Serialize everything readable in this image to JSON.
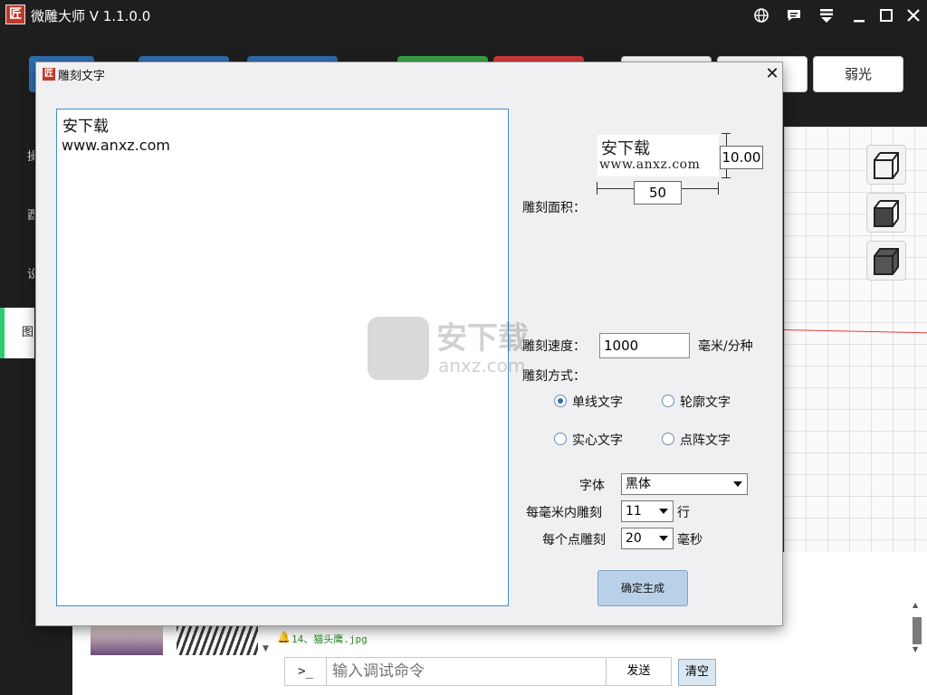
{
  "app": {
    "logo_char": "匠",
    "title": "微雕大师 V 1.1.0.0"
  },
  "titlebar_icons": [
    "globe-icon",
    "message-icon",
    "menu-icon",
    "minimize-icon",
    "maximize-icon",
    "close-icon"
  ],
  "toolbar": {
    "weak_light_label": "弱光"
  },
  "left_nav": {
    "items": [
      "操",
      "酉",
      "设",
      "图"
    ]
  },
  "dialog": {
    "logo_char": "匠",
    "title": "雕刻文字",
    "text_lines": [
      "安下载",
      "www.anxz.com"
    ],
    "area_label": "雕刻面积：",
    "preview_lines": [
      "安下载",
      "www.anxz.com"
    ],
    "height_value": "10.00",
    "width_value": "50",
    "speed_label": "雕刻速度：",
    "speed_value": "1000",
    "speed_unit": "毫米/分种",
    "mode_label": "雕刻方式：",
    "modes": [
      {
        "label": "单线文字",
        "selected": true
      },
      {
        "label": "轮廓文字",
        "selected": false
      },
      {
        "label": "实心文字",
        "selected": false
      },
      {
        "label": "点阵文字",
        "selected": false
      }
    ],
    "font_label": "字体",
    "font_value": "黑体",
    "lines_per_mm_label": "每毫米内雕刻",
    "lines_per_mm_value": "11",
    "lines_unit": "行",
    "dot_time_label": "每个点雕刻",
    "dot_time_value": "20",
    "dot_time_unit": "毫秒",
    "generate_label": "确定生成"
  },
  "watermark": {
    "text_cn": "安下载",
    "text_en": "anxz.com"
  },
  "console": {
    "log_line": "14、猫头鹰.jpg",
    "prompt": ">_",
    "placeholder": "输入调试命令",
    "send_label": "发送",
    "clear_label": "清空"
  },
  "colors": {
    "brand_red": "#c0392b",
    "toolbar_blue": "#2f6fb0",
    "toolbar_green": "#3aa64a",
    "toolbar_red": "#d23b3b",
    "nav_active": "#2ecc71",
    "dialog_bg": "#f0eff2",
    "accent_blue": "#3f8fd0"
  }
}
